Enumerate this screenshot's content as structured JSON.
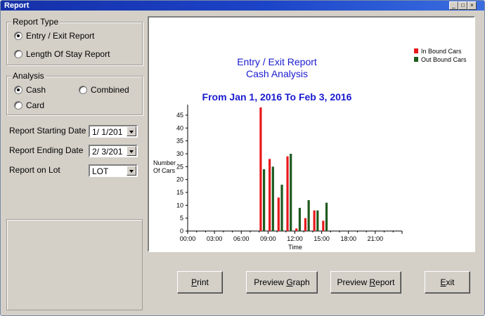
{
  "window": {
    "title": "Report"
  },
  "report_type": {
    "legend": "Report Type",
    "options": [
      "Entry / Exit Report",
      "Length Of Stay Report"
    ],
    "selected": 0
  },
  "analysis": {
    "legend": "Analysis",
    "options": [
      "Cash",
      "Combined",
      "Card"
    ],
    "selected": 0
  },
  "fields": {
    "start_label": "Report Starting Date",
    "start_value": "1/ 1/201",
    "end_label": "Report Ending Date",
    "end_value": "2/ 3/201",
    "lot_label": "Report on Lot",
    "lot_value": "LOT"
  },
  "buttons": {
    "print": {
      "pre": "",
      "key": "P",
      "post": "rint"
    },
    "preview_graph": {
      "pre": "Preview ",
      "key": "G",
      "post": "raph"
    },
    "preview_report": {
      "pre": "Preview ",
      "key": "R",
      "post": "eport"
    },
    "exit": {
      "pre": "",
      "key": "E",
      "post": "xit"
    }
  },
  "colors": {
    "in_bound": "#e8181c",
    "out_bound": "#1e5a1e"
  },
  "chart_data": {
    "type": "bar",
    "title": "Entry / Exit Report",
    "subtitle": "Cash Analysis",
    "date_range": "From Jan 1, 2016  To Feb 3, 2016",
    "xlabel": "Time",
    "ylabel_line1": "Number",
    "ylabel_line2": "Of Cars",
    "xlim": [
      0,
      24
    ],
    "ylim": [
      0,
      48
    ],
    "yticks": [
      0,
      5,
      10,
      15,
      20,
      25,
      30,
      35,
      40,
      45
    ],
    "xticks": [
      "00:00",
      "03:00",
      "06:00",
      "09:00",
      "12:00",
      "15:00",
      "18:00",
      "21:00"
    ],
    "legend_position": "top-right",
    "hours": [
      8,
      9,
      10,
      11,
      12,
      13,
      14,
      15
    ],
    "series": [
      {
        "name": "In Bound Cars",
        "values": [
          48,
          28,
          13,
          29,
          1,
          5,
          8,
          4
        ]
      },
      {
        "name": "Out Bound Cars",
        "values": [
          24,
          25,
          18,
          30,
          9,
          12,
          8,
          11
        ]
      }
    ]
  }
}
